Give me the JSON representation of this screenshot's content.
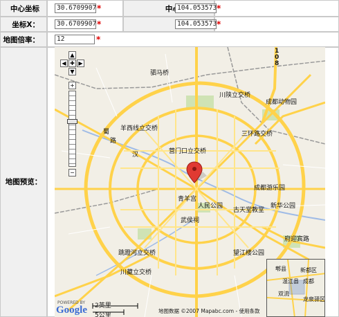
{
  "form": {
    "center_x_label": "中心坐标X：",
    "center_x_value": "30.67099079000",
    "center_y_label": "中心坐标Y：",
    "center_y_value": "104.05357360000",
    "coord_x_label": "坐标X：",
    "coord_x_value": "30.67099079000",
    "coord_y_label": "坐标Y：",
    "coord_y_value": "104.05357360000",
    "zoom_label": "地图倍率：",
    "zoom_value": "12",
    "required_mark": "*",
    "preview_label": "地图预览："
  },
  "map": {
    "labels": {
      "l1": "蜀",
      "l2": "西",
      "l3": "路",
      "l4": "蜀",
      "l5": "汉",
      "l6": "路",
      "l7": "驷马桥",
      "l8": "川陕立交桥",
      "l9": "成都动物园",
      "l10": "羊西线立交桥",
      "l11": "营门口立交桥",
      "l12": "三环路交桥",
      "l13": "成都游乐园",
      "l14": "青羊宫",
      "l15": "人民公园",
      "l16": "古天堂教堂",
      "l17": "新华公园",
      "l18": "武侯祠",
      "l19": "望江楼公园",
      "l20": "府迎宾路",
      "l21": "跳蹬河立交桥",
      "l22": "川藏立交桥",
      "l23": "2英里",
      "l24": "5公里",
      "l25": "川",
      "l26": "藏",
      "l27": "公",
      "l28": "路",
      "l29": "地图数据 ©2007 Mapabc.com - 使用条款",
      "google": "Google",
      "powered": "POWERED BY",
      "ov1": "郫县",
      "ov2": "新都区",
      "ov3": "温江县",
      "ov4": "双流",
      "ov5": "龙泉驿区",
      "ov6": "成都",
      "hw_108": "108"
    }
  }
}
